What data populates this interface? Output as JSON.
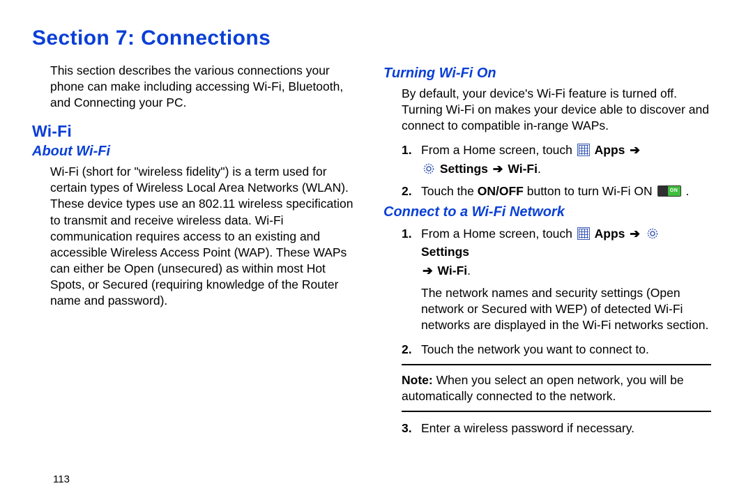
{
  "title": "Section 7: Connections",
  "page_number": "113",
  "intro": "This section describes the various connections your phone can make including accessing Wi-Fi, Bluetooth, and Connecting your PC.",
  "left": {
    "h2": "Wi-Fi",
    "h3": "About Wi-Fi",
    "body": "Wi-Fi (short for \"wireless fidelity\") is a term used for certain types of Wireless Local Area Networks (WLAN). These device types use an 802.11 wireless specification to transmit and receive wireless data. Wi-Fi communication requires access to an existing and accessible Wireless Access Point (WAP). These WAPs can either be Open (unsecured) as within most Hot Spots, or Secured (requiring knowledge of the Router name and password)."
  },
  "right": {
    "turning_on": {
      "h3": "Turning Wi-Fi On",
      "body": "By default, your device's Wi-Fi feature is turned off. Turning Wi-Fi on makes your device able to discover and connect to compatible in-range WAPs.",
      "step1_pre": "From a Home screen, touch ",
      "apps": "Apps",
      "arrow": "➔",
      "settings": "Settings",
      "wifi": "Wi-Fi",
      "step2_pre": "Touch the ",
      "onoff": "ON/OFF",
      "step2_post": " button to turn Wi-Fi ON ",
      "toggle_label": "ON"
    },
    "connect": {
      "h3": "Connect to a Wi-Fi Network",
      "step1_pre": "From a Home screen, touch ",
      "apps": "Apps",
      "arrow": "➔",
      "settings": "Settings",
      "wifi": "Wi-Fi",
      "step1_body": "The network names and security settings (Open network or Secured with WEP) of detected Wi-Fi networks are displayed in the Wi-Fi networks section.",
      "step2": "Touch the network you want to connect to.",
      "note_label": "Note:",
      "note_body": " When you select an open network, you will be automatically connected to the network.",
      "step3": "Enter a wireless password if necessary."
    }
  }
}
